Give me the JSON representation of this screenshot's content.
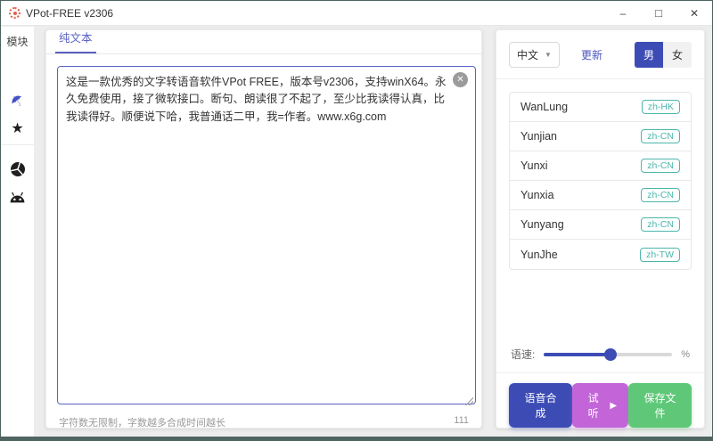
{
  "window": {
    "title": "VPot-FREE v2306",
    "minimize_glyph": "–",
    "maximize_glyph": "□",
    "close_glyph": "✕"
  },
  "sidebar": {
    "header": "模块",
    "icons": [
      "umbrella-icon",
      "star-icon",
      "shutter-icon",
      "android-icon"
    ]
  },
  "editor": {
    "tab": "纯文本",
    "text": "这是一款优秀的文字转语音软件VPot FREE，版本号v2306，支持winX64。永久免费使用，接了微软接口。断句、朗读很了不起了，至少比我读得认真，比我读得好。顺便说下哈，我普通话二甲，我=作者。www.x6g.com",
    "clear_glyph": "✕",
    "helper": "字符数无限制，字数越多合成时间越长",
    "char_count": "111"
  },
  "panel": {
    "language_value": "中文",
    "language_caret": "▼",
    "update_label": "更新",
    "gender_male": "男",
    "gender_female": "女",
    "voices": [
      {
        "name": "WanLung",
        "lang": "zh-HK"
      },
      {
        "name": "Yunjian",
        "lang": "zh-CN"
      },
      {
        "name": "Yunxi",
        "lang": "zh-CN"
      },
      {
        "name": "Yunxia",
        "lang": "zh-CN"
      },
      {
        "name": "Yunyang",
        "lang": "zh-CN"
      },
      {
        "name": "YunJhe",
        "lang": "zh-TW"
      }
    ],
    "speed_label": "语速:",
    "speed_unit": "%",
    "speed_value_pct": 52,
    "buttons": {
      "synthesize": "语音合成",
      "preview": "试听",
      "preview_glyph": "▶",
      "save": "保存文件"
    }
  },
  "colors": {
    "accent_indigo": "#3d4cb5",
    "tab_indigo": "#5a62c3",
    "badge_teal": "#4db6ac",
    "preview_purple": "#c364d9",
    "save_green": "#5fc878",
    "frame_dark": "#4f6561"
  }
}
